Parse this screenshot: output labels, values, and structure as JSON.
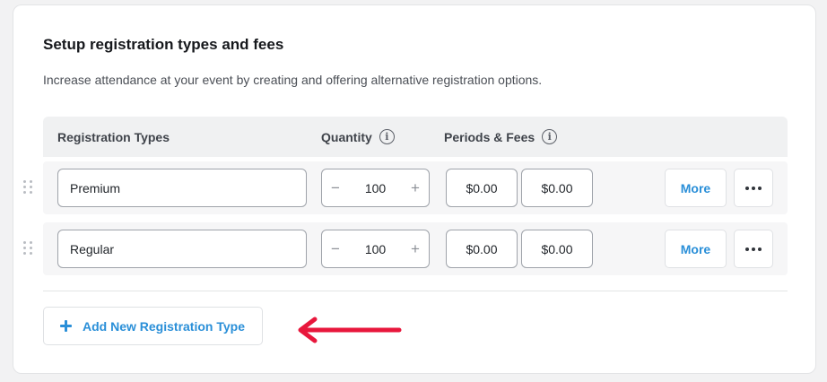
{
  "section": {
    "title": "Setup registration types and fees",
    "description": "Increase attendance at your event by creating and offering alternative registration options."
  },
  "table": {
    "headers": {
      "registration_types": "Registration Types",
      "quantity": "Quantity",
      "periods_fees": "Periods & Fees"
    },
    "info_glyph": "i",
    "rows": [
      {
        "name": "Premium",
        "quantity": "100",
        "fees": [
          "$0.00",
          "$0.00"
        ],
        "more_label": "More"
      },
      {
        "name": "Regular",
        "quantity": "100",
        "fees": [
          "$0.00",
          "$0.00"
        ],
        "more_label": "More"
      }
    ],
    "stepper": {
      "minus": "−",
      "plus": "+"
    }
  },
  "add_button": {
    "label": "Add New Registration Type"
  },
  "icons": {
    "drag_handle": "drag-handle-icon",
    "info": "info-icon",
    "more_options": "more-options-icon",
    "plus": "plus-icon",
    "annotation_arrow": "arrow-left-icon"
  },
  "colors": {
    "accent": "#2a8fd8",
    "annotation": "#e8173c"
  }
}
